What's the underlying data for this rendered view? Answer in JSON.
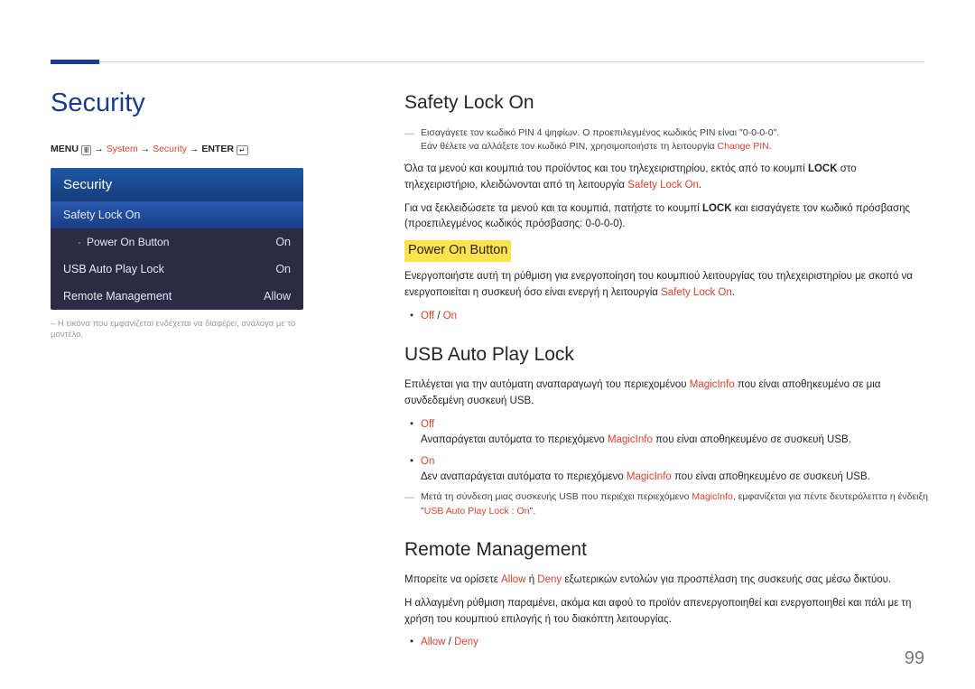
{
  "page_title": "Security",
  "breadcrumb": {
    "menu": "MENU",
    "arrow": "→",
    "system": "System",
    "security": "Security",
    "enter": "ENTER"
  },
  "menu": {
    "header": "Security",
    "rows": [
      {
        "label": "Safety Lock On",
        "value": "",
        "highlight": true
      },
      {
        "label": "Power On Button",
        "value": "On",
        "sub": true
      },
      {
        "label": "USB Auto Play Lock",
        "value": "On"
      },
      {
        "label": "Remote Management",
        "value": "Allow"
      }
    ]
  },
  "left_footnote": "– Η εικόνα που εμφανίζεται ενδέχεται να διαφέρει, ανάλογα με το μοντέλο.",
  "safety_lock": {
    "heading": "Safety Lock On",
    "note_prefix": "Εισαγάγετε τον κωδικό PIN 4 ψηφίων. Ο προεπιλεγμένος κωδικός PIN είναι \"0-0-0-0\".",
    "note_line2_a": "Εάν θέλετε να αλλάξετε τον κωδικό PIN, χρησιμοποιήστε τη λειτουργία ",
    "note_line2_red": "Change PIN",
    "p1_a": "Όλα τα μενού και κουμπιά του προϊόντος και του τηλεχειριστηρίου, εκτός από το κουμπί ",
    "p1_b_bold": "LOCK",
    "p1_c": " στο τηλεχειριστήριο, κλειδώνονται από τη λειτουργία ",
    "p1_red": "Safety Lock On",
    "p2_a": "Για να ξεκλειδώσετε τα μενού και τα κουμπιά, πατήστε το κουμπί ",
    "p2_b_bold": "LOCK",
    "p2_c": " και εισαγάγετε τον κωδικό πρόσβασης (προεπιλεγμένος κωδικός πρόσβασης: 0-0-0-0).",
    "power_heading": "Power On Button",
    "power_p_a": "Ενεργοποιήστε αυτή τη ρύθμιση για ενεργοποίηση του κουμπιού λειτουργίας του τηλεχειριστηρίου με σκοπό να ενεργοποιείται η συσκευή όσο είναι ενεργή η λειτουργία ",
    "power_p_red": "Safety Lock On",
    "power_opts_off": "Off",
    "power_opts_on": "On"
  },
  "usb": {
    "heading": "USB Auto Play Lock",
    "p1_a": "Επιλέγεται για την αυτόματη αναπαραγωγή του περιεχομένου ",
    "p1_red": "MagicInfo",
    "p1_b": " που είναι αποθηκευμένο σε μια συνδεδεμένη συσκευή USB.",
    "off_label": "Off",
    "off_text_a": "Αναπαράγεται αυτόματα το περιεχόμενο ",
    "off_red": "MagicInfo",
    "off_text_b": " που είναι αποθηκευμένο σε συσκευή USB.",
    "on_label": "On",
    "on_text_a": "Δεν αναπαράγεται αυτόματα το περιεχόμενο ",
    "on_red": "MagicInfo",
    "on_text_b": " που είναι αποθηκευμένο σε συσκευή USB.",
    "note_a": "Μετά τη σύνδεση μιας συσκευής USB που περιέχει περιεχόμενο ",
    "note_red1": "MagicInfo",
    "note_b": ", εμφανίζεται για πέντε δευτερόλεπτα η ένδειξη \"",
    "note_red2": "USB Auto Play Lock : On",
    "note_c": "\"."
  },
  "remote": {
    "heading": "Remote Management",
    "p1_a": "Μπορείτε να ορίσετε ",
    "p1_allow": "Allow",
    "p1_b": " ή ",
    "p1_deny": "Deny",
    "p1_c": " εξωτερικών εντολών για προσπέλαση της συσκευής σας μέσω δικτύου.",
    "p2": "Η αλλαγμένη ρύθμιση παραμένει, ακόμα και αφού το προϊόν απενεργοποιηθεί και ενεργοποιηθεί και πάλι με τη χρήση του κουμπιού επιλογής ή του διακόπτη λειτουργίας.",
    "opts_allow": "Allow",
    "opts_deny": "Deny"
  },
  "page_number": "99"
}
